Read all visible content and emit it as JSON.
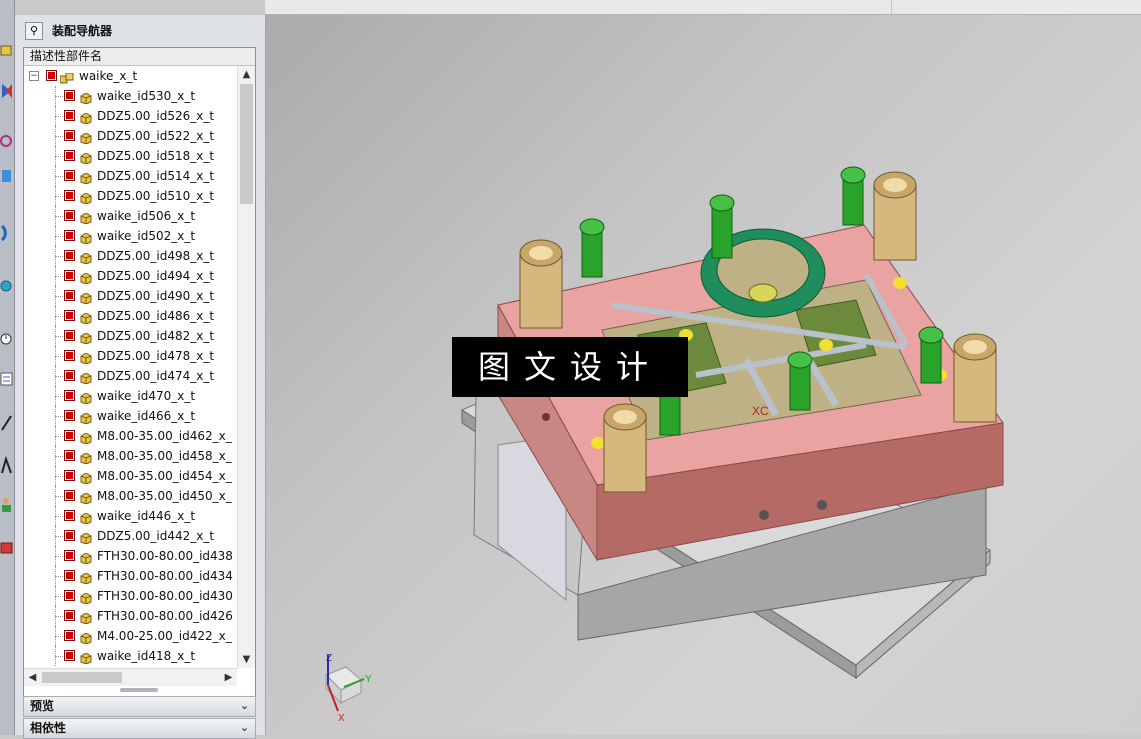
{
  "navigator": {
    "title": "装配导航器",
    "column_header": "描述性部件名",
    "root": {
      "label": "waike_x_t",
      "checked": true,
      "expanded": true
    },
    "items": [
      "waike_id530_x_t",
      "DDZ5.00_id526_x_t",
      "DDZ5.00_id522_x_t",
      "DDZ5.00_id518_x_t",
      "DDZ5.00_id514_x_t",
      "DDZ5.00_id510_x_t",
      "waike_id506_x_t",
      "waike_id502_x_t",
      "DDZ5.00_id498_x_t",
      "DDZ5.00_id494_x_t",
      "DDZ5.00_id490_x_t",
      "DDZ5.00_id486_x_t",
      "DDZ5.00_id482_x_t",
      "DDZ5.00_id478_x_t",
      "DDZ5.00_id474_x_t",
      "waike_id470_x_t",
      "waike_id466_x_t",
      "M8.00-35.00_id462_x_",
      "M8.00-35.00_id458_x_",
      "M8.00-35.00_id454_x_",
      "M8.00-35.00_id450_x_",
      "waike_id446_x_t",
      "DDZ5.00_id442_x_t",
      "FTH30.00-80.00_id438",
      "FTH30.00-80.00_id434",
      "FTH30.00-80.00_id430",
      "FTH30.00-80.00_id426",
      "M4.00-25.00_id422_x_",
      "waike_id418_x_t"
    ],
    "panels": [
      {
        "label": "预览"
      },
      {
        "label": "相依性"
      }
    ]
  },
  "viewport": {
    "watermark": "图文设计",
    "axis_labels": {
      "z": "Z",
      "y": "Y",
      "x": "X"
    },
    "csys_label": "XC"
  },
  "colors": {
    "plate_pink": "#e9a3a0",
    "plate_pink_side": "#b66a66",
    "plate_grey": "#a9a9a9",
    "bushing_tan": "#d6b77e",
    "screw_green": "#2aa32a",
    "ring_green": "#1f8d5c",
    "cavity_tan": "#bfb186",
    "core_green": "#6c8a3c",
    "pin_grey": "#b9c2cb",
    "check_red": "#c80000"
  }
}
